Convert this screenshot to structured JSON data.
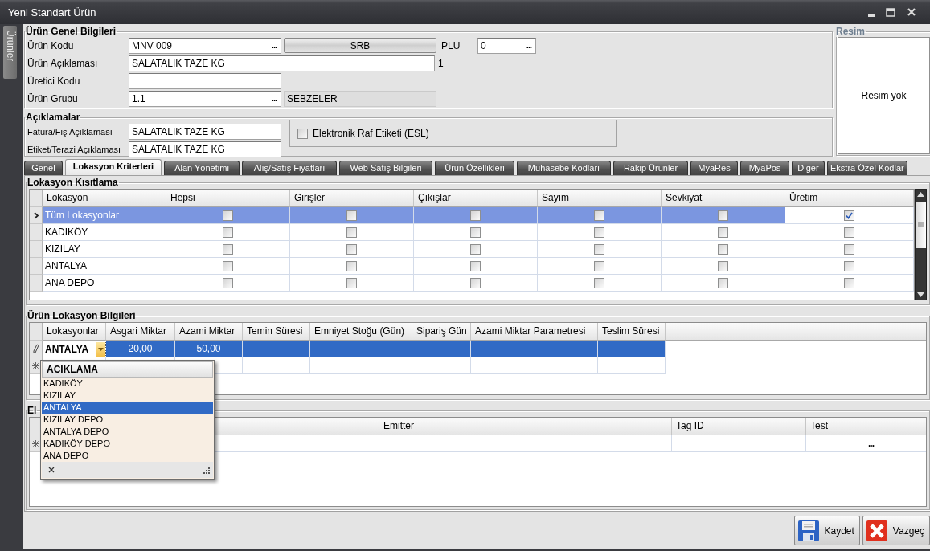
{
  "window": {
    "title": "Yeni Standart Ürün"
  },
  "side_tab": {
    "label": "Ürünler"
  },
  "general": {
    "title": "Ürün Genel Bilgileri",
    "product_code": {
      "label": "Ürün Kodu",
      "value": "MNV 009",
      "browse_button": "..."
    },
    "srb_button": "SRB",
    "plu": {
      "label": "PLU",
      "value": "0",
      "browse_button": "..."
    },
    "description": {
      "label": "Ürün Açıklaması",
      "value": "SALATALIK TAZE KG",
      "note": "1"
    },
    "manufacturer_code": {
      "label": "Üretici Kodu"
    },
    "product_group": {
      "label": "Ürün Grubu",
      "value": "1.1",
      "browse_button": "...",
      "group_name": "SEBZELER"
    }
  },
  "descriptions": {
    "title": "Açıklamalar",
    "invoice": {
      "label": "Fatura/Fiş Açıklaması",
      "value": "SALATALIK TAZE KG"
    },
    "scale_label": {
      "label": "Etiket/Terazi Açıklaması",
      "value": "SALATALIK TAZE KG"
    },
    "esl": {
      "label": "Elektronik Raf Etiketi (ESL)",
      "checked": false
    }
  },
  "picture_box": {
    "title": "Resim",
    "empty_text": "Resim yok"
  },
  "tabs": [
    {
      "label": "Genel",
      "selected": false
    },
    {
      "label": "Lokasyon Kriterleri",
      "selected": true
    },
    {
      "label": "Alan Yönetimi",
      "selected": false
    },
    {
      "label": "Alış/Satış Fiyatları",
      "selected": false
    },
    {
      "label": "Web Satış Bilgileri",
      "selected": false
    },
    {
      "label": "Ürün Özellikleri",
      "selected": false
    },
    {
      "label": "Muhasebe Kodları",
      "selected": false
    },
    {
      "label": "Rakip Ürünler",
      "selected": false
    },
    {
      "label": "MyaRes",
      "selected": false
    },
    {
      "label": "MyaPos",
      "selected": false
    },
    {
      "label": "Diğer",
      "selected": false
    },
    {
      "label": "Ekstra Özel Kodlar",
      "selected": false
    }
  ],
  "location_restriction": {
    "title": "Lokasyon Kısıtlama",
    "columns": [
      "Lokasyon",
      "Hepsi",
      "Girişler",
      "Çıkışlar",
      "Sayım",
      "Sevkiyat",
      "Üretim"
    ],
    "rows": [
      {
        "location": "Tüm Lokasyonlar",
        "selected": true,
        "cells": [
          {
            "checked": false
          },
          {
            "checked": false
          },
          {
            "checked": false
          },
          {
            "checked": false
          },
          {
            "checked": false
          },
          {
            "checked": true
          }
        ]
      },
      {
        "location": "KADIKÖY",
        "selected": false,
        "cells": [
          {
            "checked": false
          },
          {
            "checked": false
          },
          {
            "checked": false
          },
          {
            "checked": false
          },
          {
            "checked": false
          },
          {
            "checked": false
          }
        ]
      },
      {
        "location": "KIZILAY",
        "selected": false,
        "cells": [
          {
            "checked": false
          },
          {
            "checked": false
          },
          {
            "checked": false
          },
          {
            "checked": false
          },
          {
            "checked": false
          },
          {
            "checked": false
          }
        ]
      },
      {
        "location": "ANTALYA",
        "selected": false,
        "cells": [
          {
            "checked": false
          },
          {
            "checked": false
          },
          {
            "checked": false
          },
          {
            "checked": false
          },
          {
            "checked": false
          },
          {
            "checked": false
          }
        ]
      },
      {
        "location": "ANA DEPO",
        "selected": false,
        "cells": [
          {
            "checked": false
          },
          {
            "checked": false
          },
          {
            "checked": false
          },
          {
            "checked": false
          },
          {
            "checked": false
          },
          {
            "checked": false
          }
        ]
      }
    ]
  },
  "location_info": {
    "title": "Ürün Lokasyon Bilgileri",
    "columns": [
      "Lokasyonlar",
      "Asgari Miktar",
      "Azami Miktar",
      "Temin Süresi",
      "Emniyet Stoğu (Gün)",
      "Sipariş Gün",
      "Azami Miktar Parametresi",
      "Teslim Süresi"
    ],
    "rows": [
      {
        "kind": "editing",
        "cells": [
          "ANTALYA",
          "20,00",
          "50,00"
        ]
      },
      {
        "kind": "new"
      }
    ],
    "dropdown": {
      "header": "ACIKLAMA",
      "items": [
        {
          "label": "KADIKÖY",
          "selected": false
        },
        {
          "label": "KIZILAY",
          "selected": false
        },
        {
          "label": "ANTALYA",
          "selected": true
        },
        {
          "label": "KIZILAY DEPO",
          "selected": false
        },
        {
          "label": "ANTALYA DEPO",
          "selected": false
        },
        {
          "label": "KADIKÖY DEPO",
          "selected": false
        },
        {
          "label": "ANA DEPO",
          "selected": false
        }
      ]
    }
  },
  "esl_tags": {
    "title": "El",
    "columns": [
      "Emitter",
      "Tag ID",
      "Test"
    ],
    "rows": [
      {
        "kind": "new",
        "test_button": "..."
      }
    ]
  },
  "buttons": [
    {
      "label": "Kaydet",
      "kind": "save"
    },
    {
      "label": "Vazgeç",
      "kind": "cancel"
    }
  ]
}
